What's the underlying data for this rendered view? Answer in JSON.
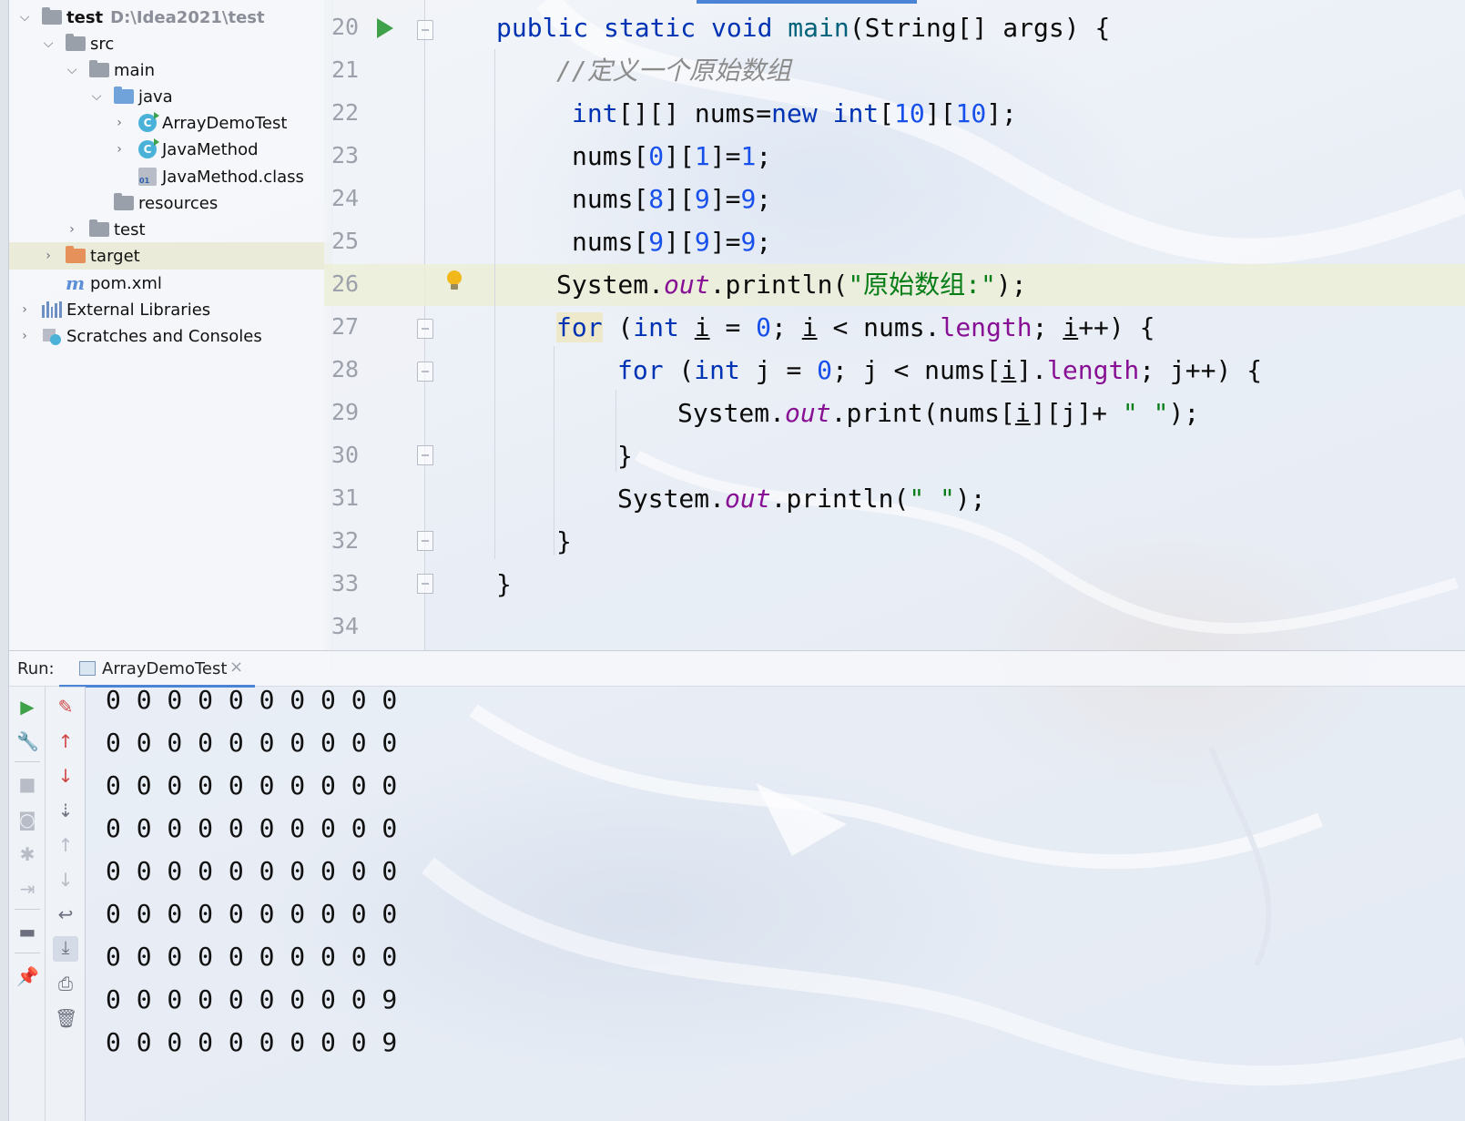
{
  "project_tree": {
    "root": {
      "label": "test",
      "path": "D:\\Idea2021\\test"
    },
    "items": [
      {
        "label": "src"
      },
      {
        "label": "main"
      },
      {
        "label": "java"
      },
      {
        "label": "ArrayDemoTest"
      },
      {
        "label": "JavaMethod"
      },
      {
        "label": "JavaMethod.class"
      },
      {
        "label": "resources"
      },
      {
        "label": "test"
      },
      {
        "label": "target"
      },
      {
        "label": "pom.xml"
      },
      {
        "label": "External Libraries"
      },
      {
        "label": "Scratches and Consoles"
      }
    ]
  },
  "editor": {
    "line_numbers": [
      "20",
      "21",
      "22",
      "23",
      "24",
      "25",
      "26",
      "27",
      "28",
      "29",
      "30",
      "31",
      "32",
      "33",
      "34"
    ],
    "current_line": "26",
    "code": {
      "l20": {
        "a": "public static void ",
        "b": "main",
        "c": "(String[] args) {"
      },
      "l21": {
        "a": "//定义一个原始数组"
      },
      "l22": {
        "a": "int",
        "b": "[][] nums=",
        "c": "new ",
        "d": "int",
        "e": "[",
        "f": "10",
        "g": "][",
        "h": "10",
        "i": "];"
      },
      "l23": {
        "a": "nums[",
        "b": "0",
        "c": "][",
        "d": "1",
        "e": "]=",
        "f": "1",
        "g": ";"
      },
      "l24": {
        "a": "nums[",
        "b": "8",
        "c": "][",
        "d": "9",
        "e": "]=",
        "f": "9",
        "g": ";"
      },
      "l25": {
        "a": "nums[",
        "b": "9",
        "c": "][",
        "d": "9",
        "e": "]=",
        "f": "9",
        "g": ";"
      },
      "l26": {
        "a": "System.",
        "b": "out",
        "c": ".println(",
        "d": "\"原始数组:\"",
        "e": ");"
      },
      "l27": {
        "a": "for",
        "b": " (",
        "c": "int ",
        "d": "i",
        "e": " = ",
        "f": "0",
        "g": "; ",
        "h": "i",
        "i": " < nums.",
        "j": "length",
        "k": "; ",
        "l": "i",
        "m": "++) {"
      },
      "l28": {
        "a": "for",
        "b": " (",
        "c": "int ",
        "d": "j = ",
        "e": "0",
        "f": "; j < nums[",
        "g": "i",
        "h": "].",
        "i": "length",
        "j": "; j++) {"
      },
      "l29": {
        "a": "System.",
        "b": "out",
        "c": ".print(nums[",
        "d": "i",
        "e": "][j]+ ",
        "f": "\" \"",
        "g": ");"
      },
      "l30": {
        "a": "}"
      },
      "l31": {
        "a": "System.",
        "b": "out",
        "c": ".println(",
        "d": "\" \"",
        "e": ");"
      },
      "l32": {
        "a": "}"
      },
      "l33": {
        "a": "}"
      }
    }
  },
  "run_panel": {
    "label": "Run:",
    "tab_label": "ArrayDemoTest",
    "tab_close": "×",
    "output_lines": [
      "0 0 0 0 0 0 0 0 0 0",
      "0 0 0 0 0 0 0 0 0 0",
      "0 0 0 0 0 0 0 0 0 0",
      "0 0 0 0 0 0 0 0 0 0",
      "0 0 0 0 0 0 0 0 0 0",
      "0 0 0 0 0 0 0 0 0 0",
      "0 0 0 0 0 0 0 0 0 0",
      "0 0 0 0 0 0 0 0 0 9",
      "0 0 0 0 0 0 0 0 0 9"
    ]
  },
  "colors": {
    "keyword": "#0033b3",
    "number": "#1750eb",
    "string": "#067d17",
    "field": "#871094",
    "comment": "#8c8c8c",
    "accent": "#4b84d4"
  }
}
